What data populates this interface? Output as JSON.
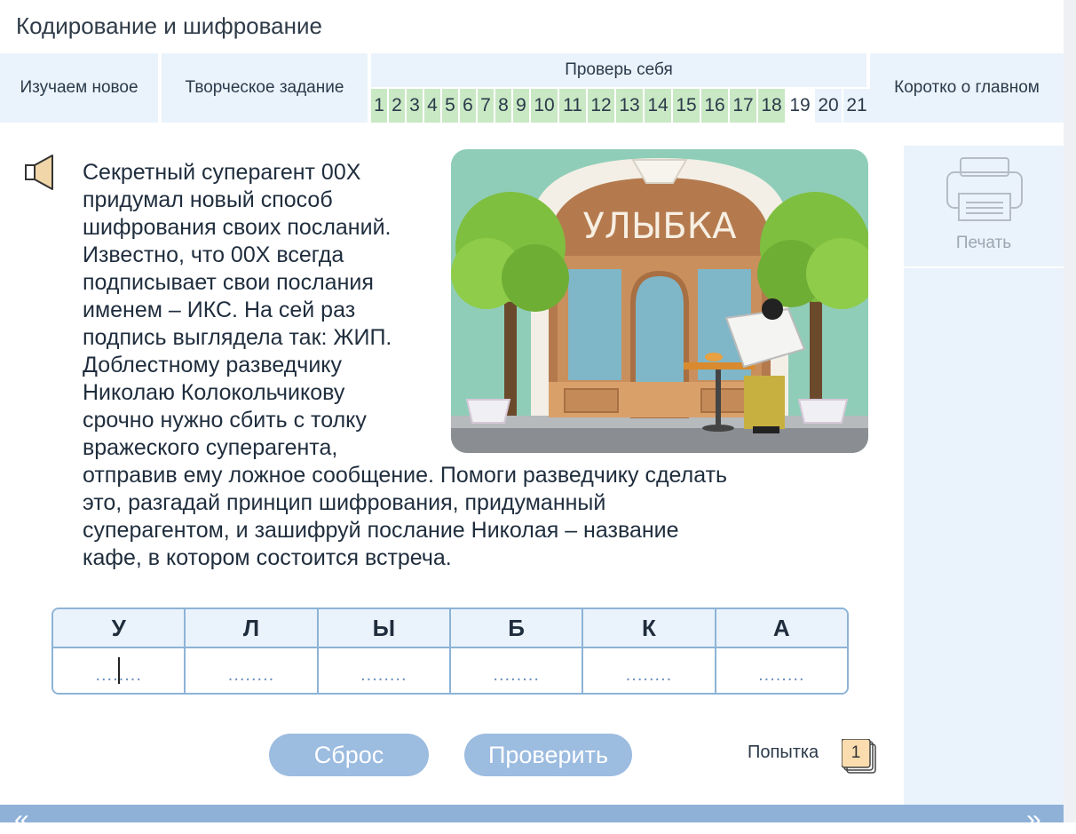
{
  "header": {
    "title": "Кодирование и шифрование"
  },
  "tabs": {
    "learn": "Изучаем новое",
    "creative": "Творческое задание",
    "check": "Проверь себя",
    "summary": "Коротко о главном",
    "numbers": [
      "1",
      "2",
      "3",
      "4",
      "5",
      "6",
      "7",
      "8",
      "9",
      "10",
      "11",
      "12",
      "13",
      "14",
      "15",
      "16",
      "17",
      "18",
      "19",
      "20",
      "21"
    ]
  },
  "task": {
    "lines": [
      "Секретный суперагент 00Х",
      "придумал новый способ",
      "шифрования своих посланий.",
      "Известно, что 00Х всегда",
      "подписывает свои послания",
      "именем – ИКС. На сей раз",
      "подпись выглядела так: ЖИП.",
      "Доблестному разведчику",
      "Николаю Колокольчикову",
      "срочно нужно сбить с толку",
      "вражеского суперагента,",
      "отправив ему ложное сообщение. Помоги разведчику сделать",
      "это, разгадай принцип шифрования, придуманный",
      "суперагентом, и зашифруй послание Николая – название",
      "кафе, в котором состоится встреча."
    ],
    "image_sign": "УЛЫБКА"
  },
  "table": {
    "letters": [
      "У",
      "Л",
      "Ы",
      "Б",
      "К",
      "А"
    ],
    "placeholder": "........"
  },
  "buttons": {
    "reset": "Сброс",
    "check": "Проверить",
    "print": "Печать"
  },
  "attempt": {
    "label": "Попытка",
    "value": "1"
  },
  "footer": {
    "prev": "«",
    "next": "»"
  },
  "colors": {
    "done": "#c9e8c4",
    "tab_bg": "#eaf3fb",
    "button": "#9cbce0",
    "border": "#8db3d6"
  }
}
